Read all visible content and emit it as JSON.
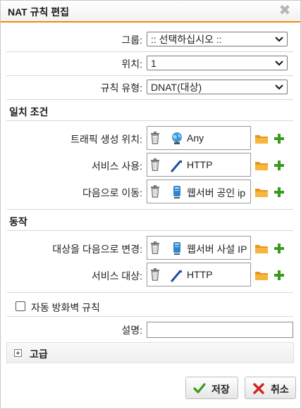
{
  "dialog": {
    "title": "NAT 규칙 편집",
    "close_glyph": "✖"
  },
  "fields": {
    "group": {
      "label": "그룹:",
      "value": ":: 선택하십시오 ::"
    },
    "position": {
      "label": "위치:",
      "value": "1"
    },
    "rule_type": {
      "label": "규칙 유형:",
      "value": "DNAT(대상)"
    }
  },
  "match_section": {
    "title": "일치 조건",
    "rows": [
      {
        "label": "트래픽 생성 위치:",
        "value": "Any",
        "icon": "globe-network-icon"
      },
      {
        "label": "서비스 사용:",
        "value": "HTTP",
        "icon": "service-wrench-icon"
      },
      {
        "label": "다음으로 이동:",
        "value": "웹서버 공인 ip",
        "icon": "host-object-icon"
      }
    ]
  },
  "action_section": {
    "title": "동작",
    "rows": [
      {
        "label": "대상을 다음으로 변경:",
        "value": "웹서버 사설 IP",
        "icon": "host-object-icon"
      },
      {
        "label": "서비스 대상:",
        "value": "HTTP",
        "icon": "service-wrench-icon"
      }
    ]
  },
  "auto_firewall": {
    "label": "자동 방화벽 규칙",
    "checked": false
  },
  "description": {
    "label": "설명:",
    "value": ""
  },
  "advanced": {
    "label": "고급"
  },
  "buttons": {
    "save": "저장",
    "cancel": "취소"
  },
  "colors": {
    "accent": "#f08c00",
    "add_green": "#3a9a1e",
    "folder_orange": "#f3a625",
    "cancel_red": "#d32222"
  }
}
